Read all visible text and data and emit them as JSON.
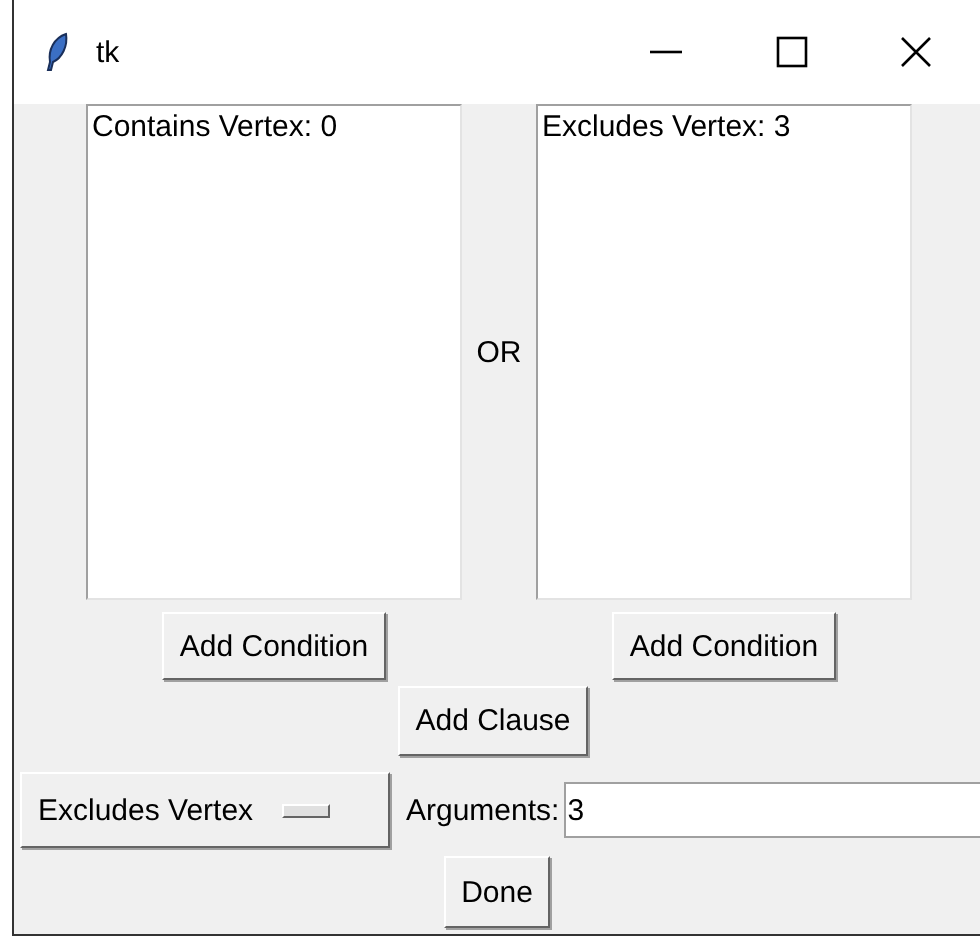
{
  "window": {
    "title": "tk"
  },
  "clauses": [
    {
      "items": [
        "Contains Vertex: 0"
      ],
      "button": "Add Condition"
    },
    {
      "items": [
        "Excludes Vertex: 3"
      ],
      "button": "Add Condition"
    }
  ],
  "separator": "OR",
  "add_clause": "Add Clause",
  "condition_menu": {
    "value": "Excludes Vertex"
  },
  "arguments": {
    "label": "Arguments:",
    "value": "3"
  },
  "done": "Done"
}
